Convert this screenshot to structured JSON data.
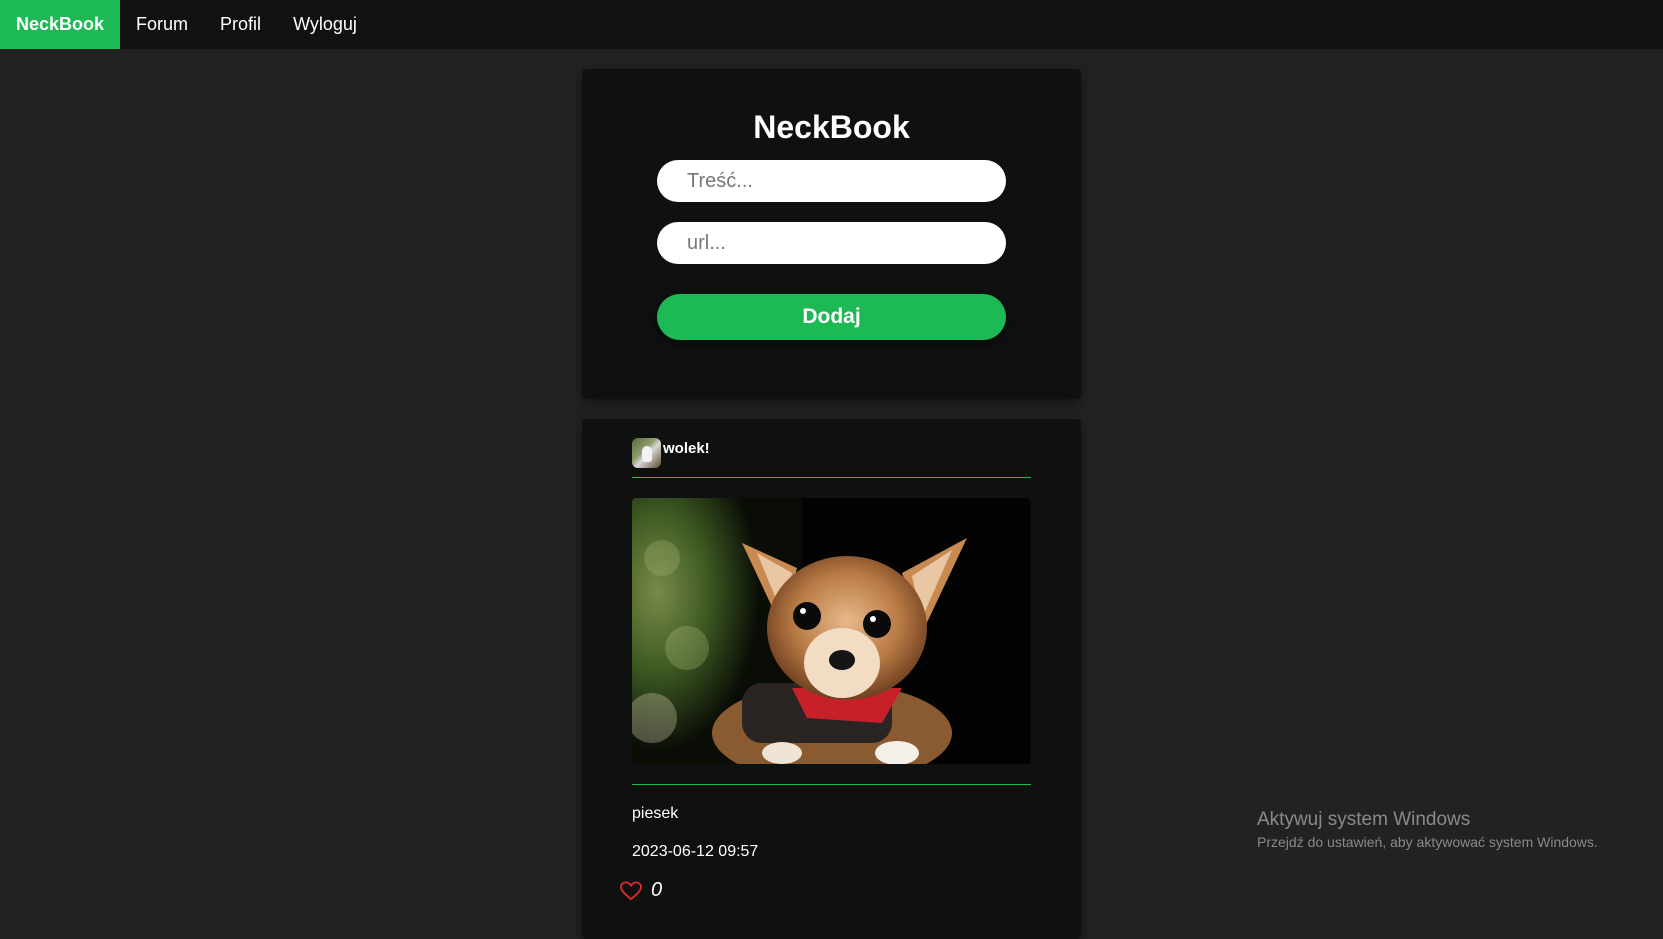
{
  "nav": {
    "brand": "NeckBook",
    "items": [
      {
        "label": "Forum"
      },
      {
        "label": "Profil"
      },
      {
        "label": "Wyloguj"
      }
    ]
  },
  "form": {
    "title": "NeckBook",
    "content_placeholder": "Treść...",
    "url_placeholder": "url...",
    "submit_label": "Dodaj"
  },
  "post": {
    "author": "wolek!",
    "text": "piesek",
    "date": "2023-06-12 09:57",
    "likes": "0"
  },
  "watermark": {
    "title": "Aktywuj system Windows",
    "subtitle": "Przejdź do ustawień, aby aktywować system Windows."
  },
  "colors": {
    "accent": "#1db954",
    "background": "#222222",
    "nav_background": "#111111",
    "card_background": "#0f1111",
    "like_heart": "#e0282e"
  },
  "icons": {
    "like": "heart-outline-icon"
  }
}
